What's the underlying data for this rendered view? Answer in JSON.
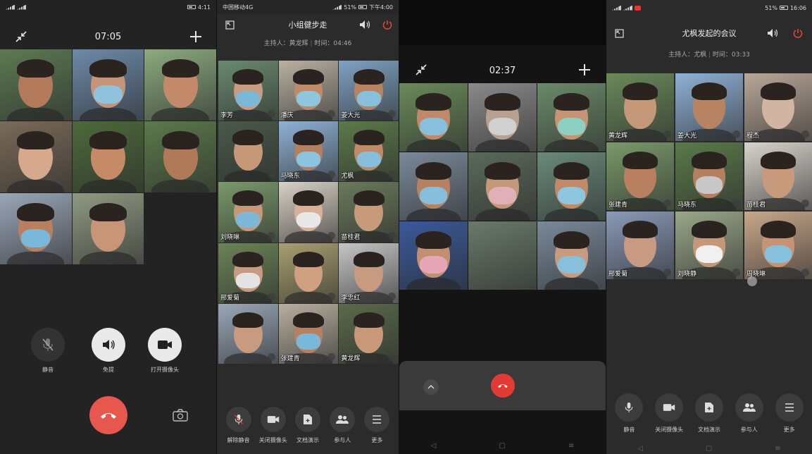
{
  "panel1": {
    "status_time": "4:11",
    "call_timer": "07:05",
    "tiles": [
      {
        "bg": "#5c7a52",
        "skin": "#b27a5a",
        "mask": ""
      },
      {
        "bg": "#6d8aa8",
        "skin": "#c69478",
        "mask": "#8fc2dc"
      },
      {
        "bg": "#8cab7e",
        "skin": "#c28a6b",
        "mask": ""
      },
      {
        "bg": "#7a6a58",
        "skin": "#d6a88c",
        "mask": ""
      },
      {
        "bg": "#4d6a3a",
        "skin": "#c58a66",
        "mask": ""
      },
      {
        "bg": "#5b7a4a",
        "skin": "#b07a5a",
        "mask": ""
      },
      {
        "bg": "#9aa6b8",
        "skin": "#b88060",
        "mask": "#7ab8da"
      },
      {
        "bg": "#8f9a82",
        "skin": "#c99578",
        "mask": ""
      }
    ],
    "controls": [
      {
        "label": "静音",
        "icon": "mic-off-icon"
      },
      {
        "label": "免提",
        "icon": "speaker-icon"
      },
      {
        "label": "打开摄像头",
        "icon": "camera-icon"
      }
    ]
  },
  "panel2": {
    "status_carrier": "中国移动4G",
    "status_battery": "51%",
    "status_time": "下午4:00",
    "title": "小组健步走",
    "host_label": "主持人：黄龙辉",
    "time_label": "时间：04:46",
    "tiles": [
      {
        "name": "李芳",
        "bg": "#6a8a70",
        "skin": "#c89a80",
        "mask": "#7ab8da"
      },
      {
        "name": "潘庆",
        "bg": "#b9b2a2",
        "skin": "#c08a6a",
        "mask": "#8ec6e0"
      },
      {
        "name": "姜大光",
        "bg": "#7fa2c2",
        "skin": "#b88362",
        "mask": "#86c0dc"
      },
      {
        "name": "",
        "bg": "#4a5a4a",
        "skin": "#c69878",
        "mask": ""
      },
      {
        "name": "马晓东",
        "bg": "#8fb2d6",
        "skin": "#b48060",
        "mask": "#8bc3e0"
      },
      {
        "name": "尤枫",
        "bg": "#5c7a4a",
        "skin": "#c08a68",
        "mask": "#86bedc"
      },
      {
        "name": "刘晓琳",
        "bg": "#7a9a6a",
        "skin": "#c49878",
        "mask": "#7eb8d8"
      },
      {
        "name": "",
        "bg": "#d8d2c6",
        "skin": "#d9b09a",
        "mask": "#e8e8e8"
      },
      {
        "name": "苗桂君",
        "bg": "#6a7a5a",
        "skin": "#c69a7a",
        "mask": ""
      },
      {
        "name": "邢爱菊",
        "bg": "#6b8456",
        "skin": "#c89a82",
        "mask": "#e4e4e4"
      },
      {
        "name": "",
        "bg": "#a8a070",
        "skin": "#d0a080",
        "mask": ""
      },
      {
        "name": "李忠红",
        "bg": "#c6c6c6",
        "skin": "#c89a80",
        "mask": ""
      },
      {
        "name": "",
        "bg": "#9aa8b8",
        "skin": "#c89a80",
        "mask": ""
      },
      {
        "name": "张建青",
        "bg": "#b8b0a0",
        "skin": "#b88060",
        "mask": "#7ab8da"
      },
      {
        "name": "黄龙辉",
        "bg": "#5a6a4a",
        "skin": "#c89878",
        "mask": ""
      }
    ],
    "controls": [
      {
        "label": "解除静音",
        "icon": "mic-off-icon"
      },
      {
        "label": "关闭摄像头",
        "icon": "camera-icon"
      },
      {
        "label": "文档演示",
        "icon": "document-icon"
      },
      {
        "label": "参与人",
        "icon": "participants-icon"
      },
      {
        "label": "更多",
        "icon": "menu-icon"
      }
    ]
  },
  "panel3": {
    "call_timer": "02:37",
    "tiles": [
      {
        "bg": "#6a8a5a",
        "skin": "#c08a6a",
        "mask": "#86c0dc"
      },
      {
        "bg": "#8a8a8a",
        "skin": "#b8a090",
        "mask": "#d0d0d0"
      },
      {
        "bg": "#6a8a6a",
        "skin": "#c69474",
        "mask": "#8cd0c4"
      },
      {
        "bg": "#7a8a9a",
        "skin": "#b88262",
        "mask": "#86bedc"
      },
      {
        "bg": "#5a6a5a",
        "skin": "#c49878",
        "mask": "#e0b0b8"
      },
      {
        "bg": "#6a8a7a",
        "skin": "#c08a6a",
        "mask": "#8ec6e0"
      },
      {
        "bg": "#3a5a9a",
        "skin": "#c09070",
        "mask": "#e6a6b6"
      },
      {
        "bg": "#6a7a6a",
        "skin": "",
        "mask": ""
      },
      {
        "bg": "#7a8a9a",
        "skin": "#c89a80",
        "mask": "#86c0dc"
      }
    ]
  },
  "panel4": {
    "status_battery": "51%",
    "status_time": "16:06",
    "title": "尤枫发起的会议",
    "host_label": "主持人：尤枫",
    "time_label": "时间：03:33",
    "tiles": [
      {
        "name": "黄龙辉",
        "bg": "#6a8a5a",
        "skin": "#c49878",
        "mask": ""
      },
      {
        "name": "姜大光",
        "bg": "#8fb2d6",
        "skin": "#b88362",
        "mask": ""
      },
      {
        "name": "程杰",
        "bg": "#b8a898",
        "skin": "#d2b4a2",
        "mask": ""
      },
      {
        "name": "张建青",
        "bg": "#7a9a6a",
        "skin": "#b88060",
        "mask": ""
      },
      {
        "name": "马晓东",
        "bg": "#5a7a4a",
        "skin": "#b48060",
        "mask": "#c8c8c8"
      },
      {
        "name": "苗桂君",
        "bg": "#d8d4cc",
        "skin": "#c69a7a",
        "mask": ""
      },
      {
        "name": "邢爱菊",
        "bg": "#8a9ab8",
        "skin": "#c89a82",
        "mask": ""
      },
      {
        "name": "刘晓静",
        "bg": "#9aa888",
        "skin": "#c49878",
        "mask": "#f0f0f0"
      },
      {
        "name": "周晓琳",
        "bg": "#c8a88a",
        "skin": "#c69474",
        "mask": "#86c0dc"
      }
    ],
    "controls": [
      {
        "label": "静音",
        "icon": "mic-icon"
      },
      {
        "label": "关闭摄像头",
        "icon": "camera-icon"
      },
      {
        "label": "文档演示",
        "icon": "document-icon"
      },
      {
        "label": "参与人",
        "icon": "participants-icon"
      },
      {
        "label": "更多",
        "icon": "menu-icon"
      }
    ]
  }
}
